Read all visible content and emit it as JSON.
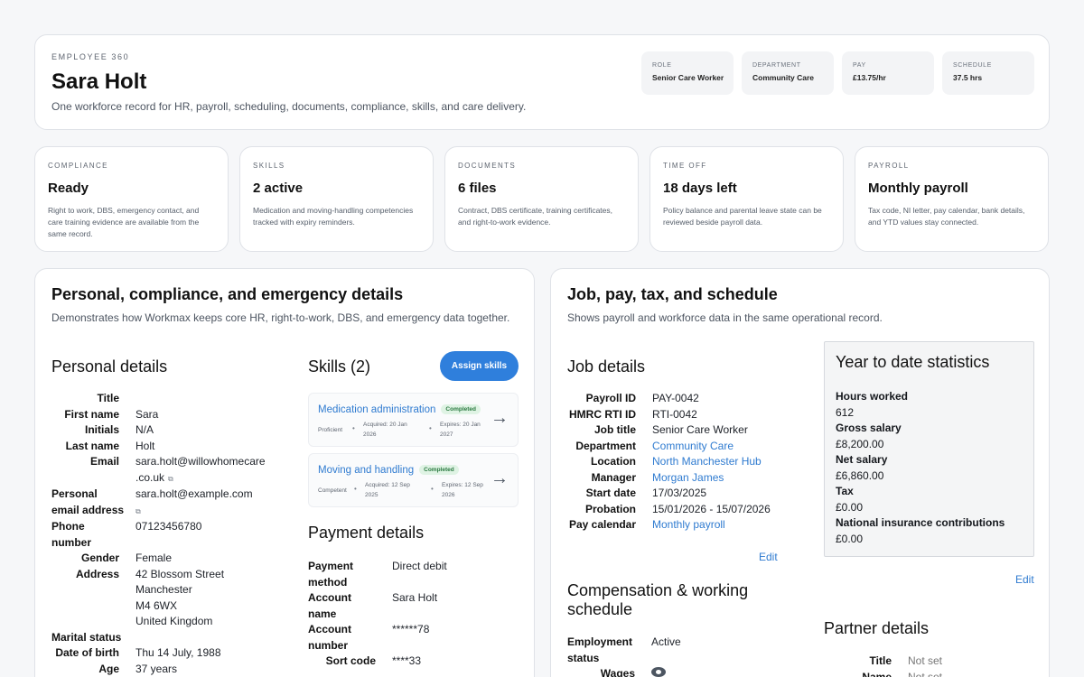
{
  "header": {
    "eyebrow": "EMPLOYEE 360",
    "name": "Sara Holt",
    "subtitle": "One workforce record for HR, payroll, scheduling, documents, compliance, skills, and care delivery.",
    "chips": [
      {
        "label": "ROLE",
        "value": "Senior Care Worker"
      },
      {
        "label": "DEPARTMENT",
        "value": "Community Care"
      },
      {
        "label": "PAY",
        "value": "£13.75/hr"
      },
      {
        "label": "SCHEDULE",
        "value": "37.5 hrs"
      }
    ]
  },
  "stats": [
    {
      "label": "COMPLIANCE",
      "value": "Ready",
      "desc": "Right to work, DBS, emergency contact, and care training evidence are available from the same record."
    },
    {
      "label": "SKILLS",
      "value": "2 active",
      "desc": "Medication and moving-handling competencies tracked with expiry reminders."
    },
    {
      "label": "DOCUMENTS",
      "value": "6 files",
      "desc": "Contract, DBS certificate, training certificates, and right-to-work evidence."
    },
    {
      "label": "TIME OFF",
      "value": "18 days left",
      "desc": "Policy balance and parental leave state can be reviewed beside payroll data."
    },
    {
      "label": "PAYROLL",
      "value": "Monthly payroll",
      "desc": "Tax code, NI letter, pay calendar, bank details, and YTD values stay connected."
    }
  ],
  "left_panel": {
    "title": "Personal, compliance, and emergency details",
    "subtitle": "Demonstrates how Workmax keeps core HR, right-to-work, DBS, and emergency data together.",
    "personal": {
      "heading": "Personal details",
      "rows": [
        {
          "k": "Title",
          "v": ""
        },
        {
          "k": "First name",
          "v": "Sara"
        },
        {
          "k": "Initials",
          "v": "N/A"
        },
        {
          "k": "Last name",
          "v": "Holt"
        },
        {
          "k": "Email",
          "v": "sara.holt@willowhomecare"
        },
        {
          "k": "",
          "v": ".co.uk"
        },
        {
          "k": "Personal",
          "v": "sara.holt@example.com"
        },
        {
          "k": "email address",
          "v": ""
        },
        {
          "k": "Phone",
          "v": "07123456780"
        },
        {
          "k": "number",
          "v": ""
        },
        {
          "k": "Gender",
          "v": "Female"
        },
        {
          "k": "Address",
          "v": "42 Blossom Street"
        },
        {
          "k": "",
          "v": "Manchester"
        },
        {
          "k": "",
          "v": "M4 6WX"
        },
        {
          "k": "",
          "v": "United Kingdom"
        },
        {
          "k": "Marital status",
          "v": ""
        },
        {
          "k": "Date of birth",
          "v": "Thu 14 July, 1988"
        },
        {
          "k": "Age",
          "v": "37 years"
        }
      ]
    },
    "skills": {
      "heading": "Skills (2)",
      "assign_label": "Assign skills",
      "items": [
        {
          "name": "Medication administration",
          "status": "Completed",
          "level": "Proficient",
          "acquired": "Acquired: 20 Jan",
          "acquired2": "2026",
          "expires": "Expires: 20 Jan",
          "expires2": "2027"
        },
        {
          "name": "Moving and handling",
          "status": "Completed",
          "level": "Competent",
          "acquired": "Acquired: 12 Sep",
          "acquired2": "2025",
          "expires": "Expires: 12 Sep",
          "expires2": "2026"
        }
      ]
    },
    "payment": {
      "heading": "Payment details",
      "rows": [
        {
          "k": "Payment",
          "v": "Direct debit"
        },
        {
          "k": "method",
          "v": ""
        },
        {
          "k": "Account",
          "v": "Sara Holt"
        },
        {
          "k": "name",
          "v": ""
        },
        {
          "k": "Account",
          "v": "******78"
        },
        {
          "k": "number",
          "v": ""
        },
        {
          "k": "Sort code",
          "v": "****33"
        }
      ]
    }
  },
  "right_panel": {
    "title": "Job, pay, tax, and schedule",
    "subtitle": "Shows payroll and workforce data in the same operational record.",
    "job": {
      "heading": "Job details",
      "rows": [
        {
          "k": "Payroll ID",
          "v": "PAY-0042",
          "link": false
        },
        {
          "k": "HMRC RTI ID",
          "v": "RTI-0042",
          "link": false
        },
        {
          "k": "Job title",
          "v": "Senior Care Worker",
          "link": false
        },
        {
          "k": "Department",
          "v": "Community Care",
          "link": true
        },
        {
          "k": "Location",
          "v": "North Manchester Hub",
          "link": true
        },
        {
          "k": "Manager",
          "v": "Morgan James",
          "link": true
        },
        {
          "k": "Start date",
          "v": "17/03/2025",
          "link": false
        },
        {
          "k": "Probation",
          "v": "15/01/2026 - 15/07/2026",
          "link": false
        },
        {
          "k": "Pay calendar",
          "v": "Monthly payroll",
          "link": true
        }
      ],
      "edit_label": "Edit"
    },
    "ytd": {
      "heading": "Year to date statistics",
      "rows": [
        {
          "k": "Hours worked",
          "v": "612"
        },
        {
          "k": "Gross salary",
          "v": "£8,200.00"
        },
        {
          "k": "Net salary",
          "v": "£6,860.00"
        },
        {
          "k": "Tax",
          "v": "£0.00"
        },
        {
          "k": "National insurance contributions",
          "v": "£0.00"
        }
      ],
      "edit_label": "Edit"
    },
    "compensation": {
      "heading_line1": "Compensation & working",
      "heading_line2": "schedule",
      "rows": [
        {
          "k": "Employment",
          "v": "Active"
        },
        {
          "k": "status",
          "v": ""
        },
        {
          "k": "Wages",
          "v": ""
        }
      ]
    },
    "partner": {
      "heading": "Partner details",
      "rows": [
        {
          "k": "Title",
          "v": "Not set"
        },
        {
          "k": "Name",
          "v": "Not set"
        }
      ]
    }
  }
}
